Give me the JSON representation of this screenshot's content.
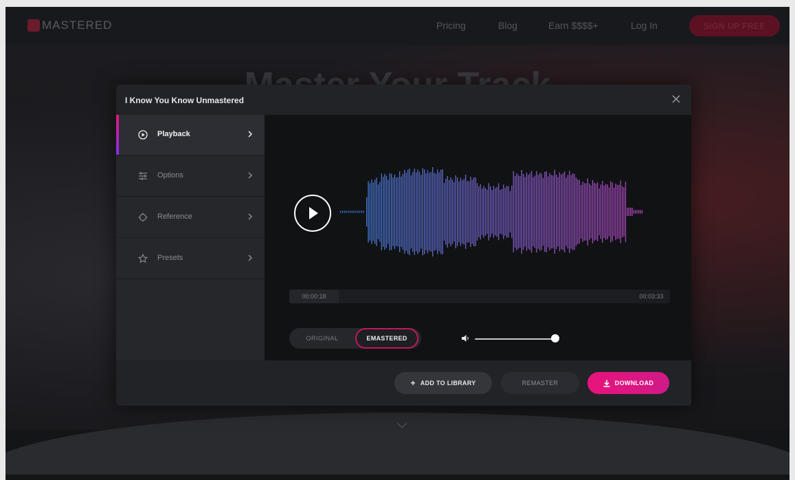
{
  "topnav": {
    "brand": "MASTERED",
    "links": [
      "Pricing",
      "Blog",
      "Earn $$$$+",
      "Log In"
    ],
    "signup_label": "SIGN UP FREE"
  },
  "hero": {
    "title": "Master Your Track"
  },
  "modal": {
    "title": "I Know You Know Unmastered",
    "sidebar": [
      {
        "label": "Playback",
        "icon": "play-circle-icon",
        "active": true
      },
      {
        "label": "Options",
        "icon": "sliders-icon",
        "active": false
      },
      {
        "label": "Reference",
        "icon": "crosshair-icon",
        "active": false
      },
      {
        "label": "Presets",
        "icon": "star-icon",
        "active": false
      }
    ],
    "player": {
      "current_time": "00:00:18",
      "total_time": "00:03:33",
      "progress": 0.085,
      "toggle": {
        "original": "ORIGINAL",
        "emastered": "EMASTERED",
        "selected": "emastered"
      },
      "volume": 1.0
    },
    "footer": {
      "add_label": "ADD TO LIBRARY",
      "remaster_label": "REMASTER",
      "download_label": "DOWNLOAD"
    }
  },
  "colors": {
    "accent": "#e8137c",
    "wave_start": "#3b7fd8",
    "wave_end": "#b043b8"
  }
}
